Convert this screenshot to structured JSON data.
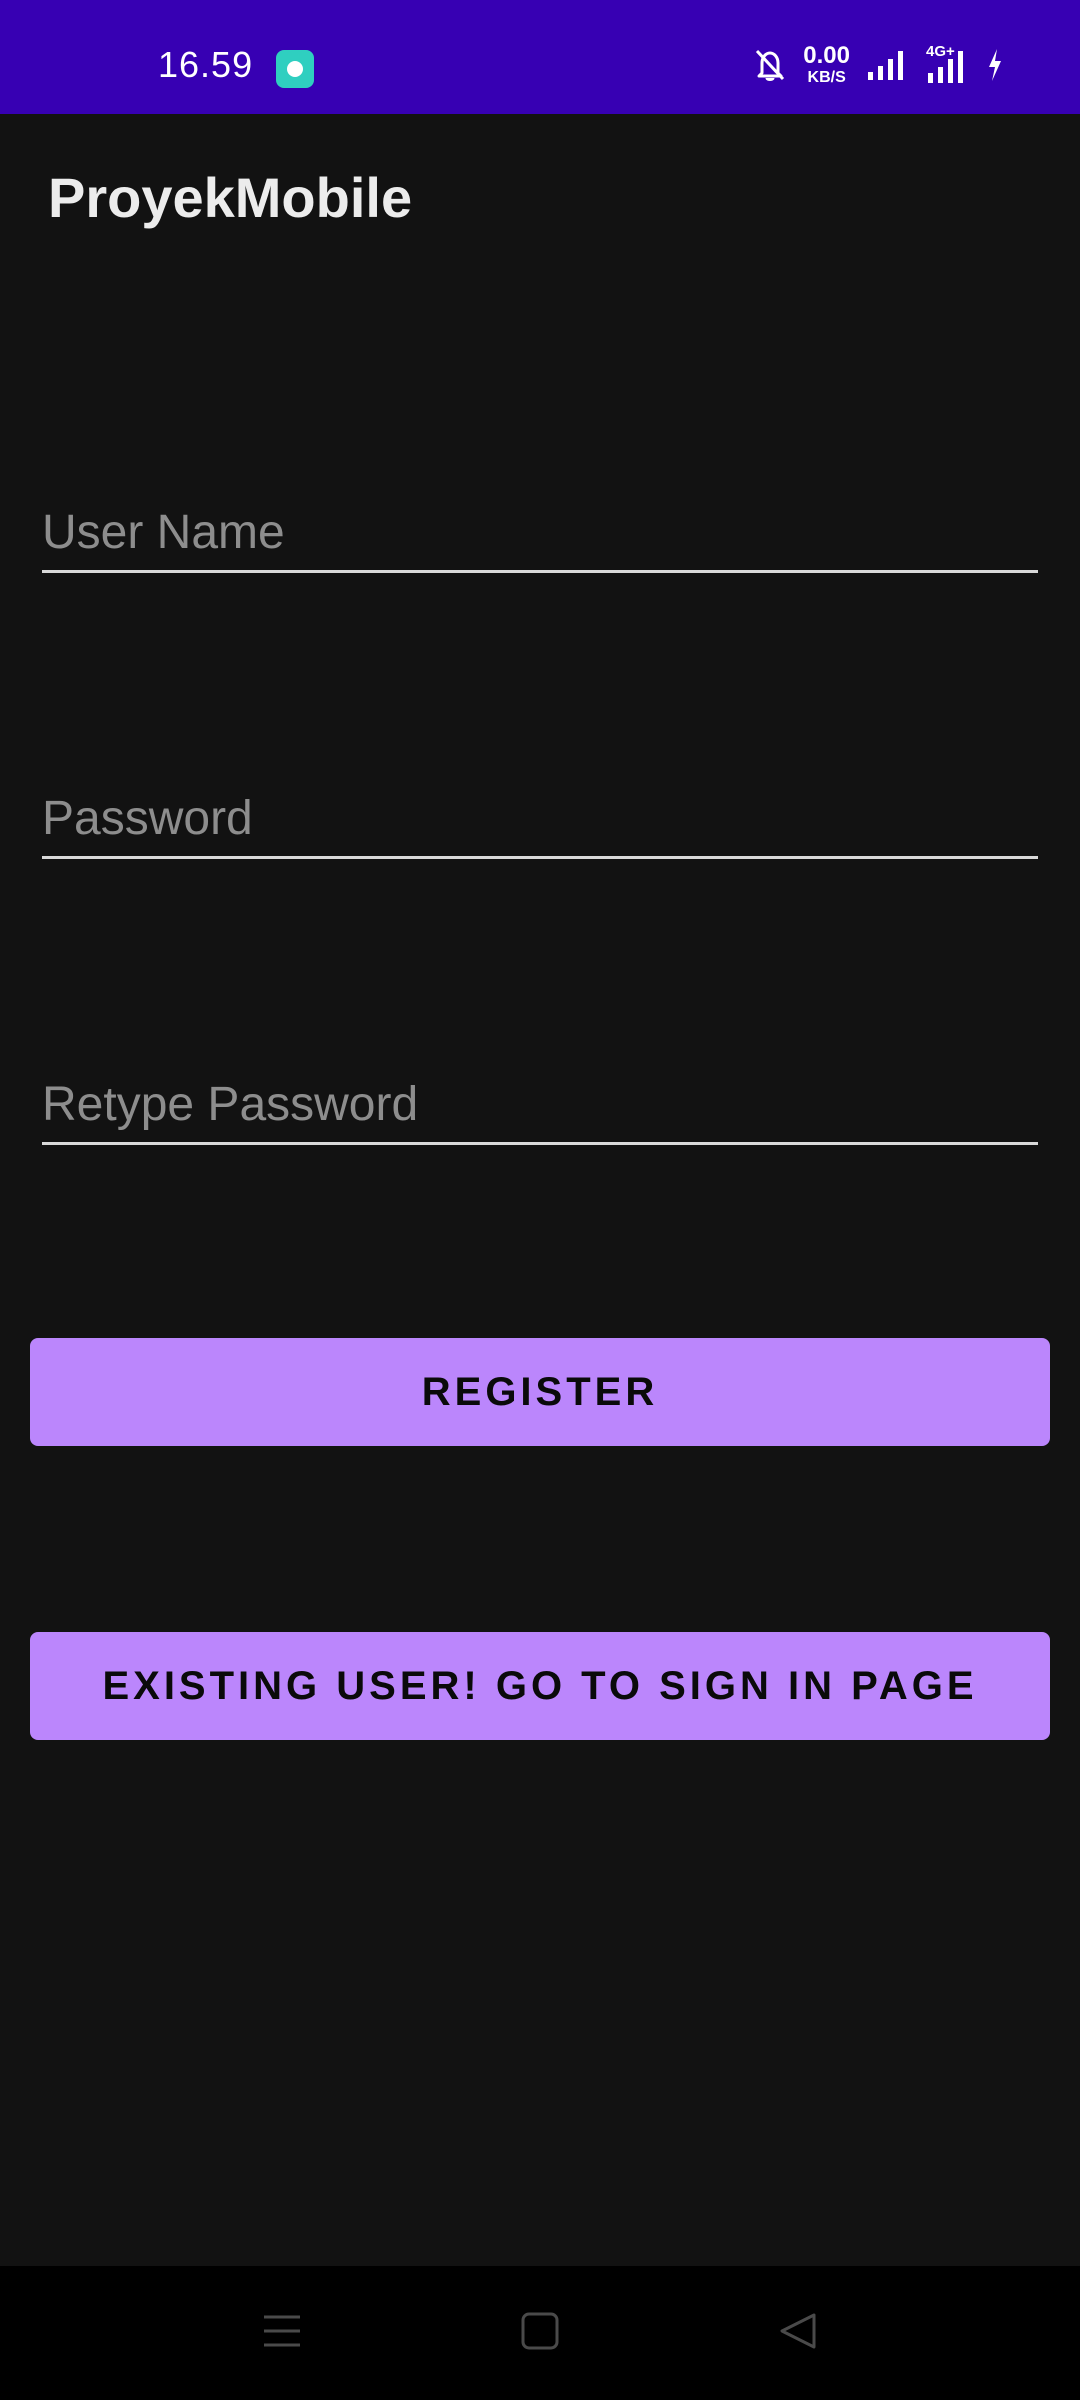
{
  "status_bar": {
    "time": "16.59",
    "net_speed_value": "0.00",
    "net_speed_unit": "KB/S",
    "network_type": "4G+",
    "icons": [
      "app-notification-icon",
      "bell-muted-icon",
      "signal-icon",
      "signal-4g-icon",
      "charging-icon"
    ]
  },
  "app": {
    "title": "ProyekMobile"
  },
  "form": {
    "username_placeholder": "User Name",
    "password_placeholder": "Password",
    "retype_password_placeholder": "Retype Password",
    "register_label": "REGISTER",
    "signin_label": "EXISTING USER! GO TO SIGN IN PAGE"
  },
  "nav_bar": {
    "icons": [
      "menu-icon",
      "home-icon",
      "back-icon"
    ]
  },
  "colors": {
    "status_bar": "#3700b3",
    "background": "#121212",
    "button": "#bb86fc",
    "button_text": "#0a0a0a",
    "underline": "#d9d9d9",
    "placeholder": "#8d8d8d"
  }
}
